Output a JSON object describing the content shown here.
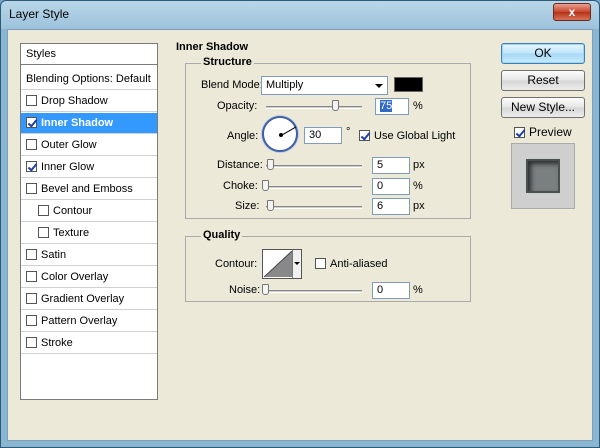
{
  "window": {
    "title": "Layer Style",
    "close_label": "x"
  },
  "sidebar": {
    "header": "Styles",
    "items": [
      {
        "label": "Blending Options: Default",
        "checkbox": false,
        "checked": false,
        "selected": false
      },
      {
        "label": "Drop Shadow",
        "checkbox": true,
        "checked": false,
        "selected": false
      },
      {
        "label": "Inner Shadow",
        "checkbox": true,
        "checked": true,
        "selected": true
      },
      {
        "label": "Outer Glow",
        "checkbox": true,
        "checked": false,
        "selected": false
      },
      {
        "label": "Inner Glow",
        "checkbox": true,
        "checked": true,
        "selected": false
      },
      {
        "label": "Bevel and Emboss",
        "checkbox": true,
        "checked": false,
        "selected": false
      },
      {
        "label": "Contour",
        "checkbox": true,
        "checked": false,
        "selected": false,
        "indent": true
      },
      {
        "label": "Texture",
        "checkbox": true,
        "checked": false,
        "selected": false,
        "indent": true
      },
      {
        "label": "Satin",
        "checkbox": true,
        "checked": false,
        "selected": false
      },
      {
        "label": "Color Overlay",
        "checkbox": true,
        "checked": false,
        "selected": false
      },
      {
        "label": "Gradient Overlay",
        "checkbox": true,
        "checked": false,
        "selected": false
      },
      {
        "label": "Pattern Overlay",
        "checkbox": true,
        "checked": false,
        "selected": false
      },
      {
        "label": "Stroke",
        "checkbox": true,
        "checked": false,
        "selected": false
      }
    ]
  },
  "inner_shadow": {
    "title": "Inner Shadow",
    "structure": {
      "title": "Structure",
      "blend_mode_label": "Blend Mode:",
      "blend_mode_value": "Multiply",
      "shadow_color": "#000000",
      "opacity_label": "Opacity:",
      "opacity_value": "75",
      "opacity_unit": "%",
      "opacity_level": 0.75,
      "angle_label": "Angle:",
      "angle_value": "30",
      "angle_unit": "°",
      "use_global_light_label": "Use Global Light",
      "use_global_light": true,
      "distance_label": "Distance:",
      "distance_value": "5",
      "distance_unit": "px",
      "choke_label": "Choke:",
      "choke_value": "0",
      "choke_unit": "%",
      "size_label": "Size:",
      "size_value": "6",
      "size_unit": "px"
    },
    "quality": {
      "title": "Quality",
      "contour_label": "Contour:",
      "anti_aliased_label": "Anti-aliased",
      "anti_aliased": false,
      "noise_label": "Noise:",
      "noise_value": "0",
      "noise_unit": "%"
    }
  },
  "buttons": {
    "ok": "OK",
    "reset": "Reset",
    "new_style": "New Style...",
    "preview_label": "Preview",
    "preview_checked": true
  },
  "colors": {
    "selection": "#3399ff",
    "title_bar": "#9cc3dc"
  }
}
